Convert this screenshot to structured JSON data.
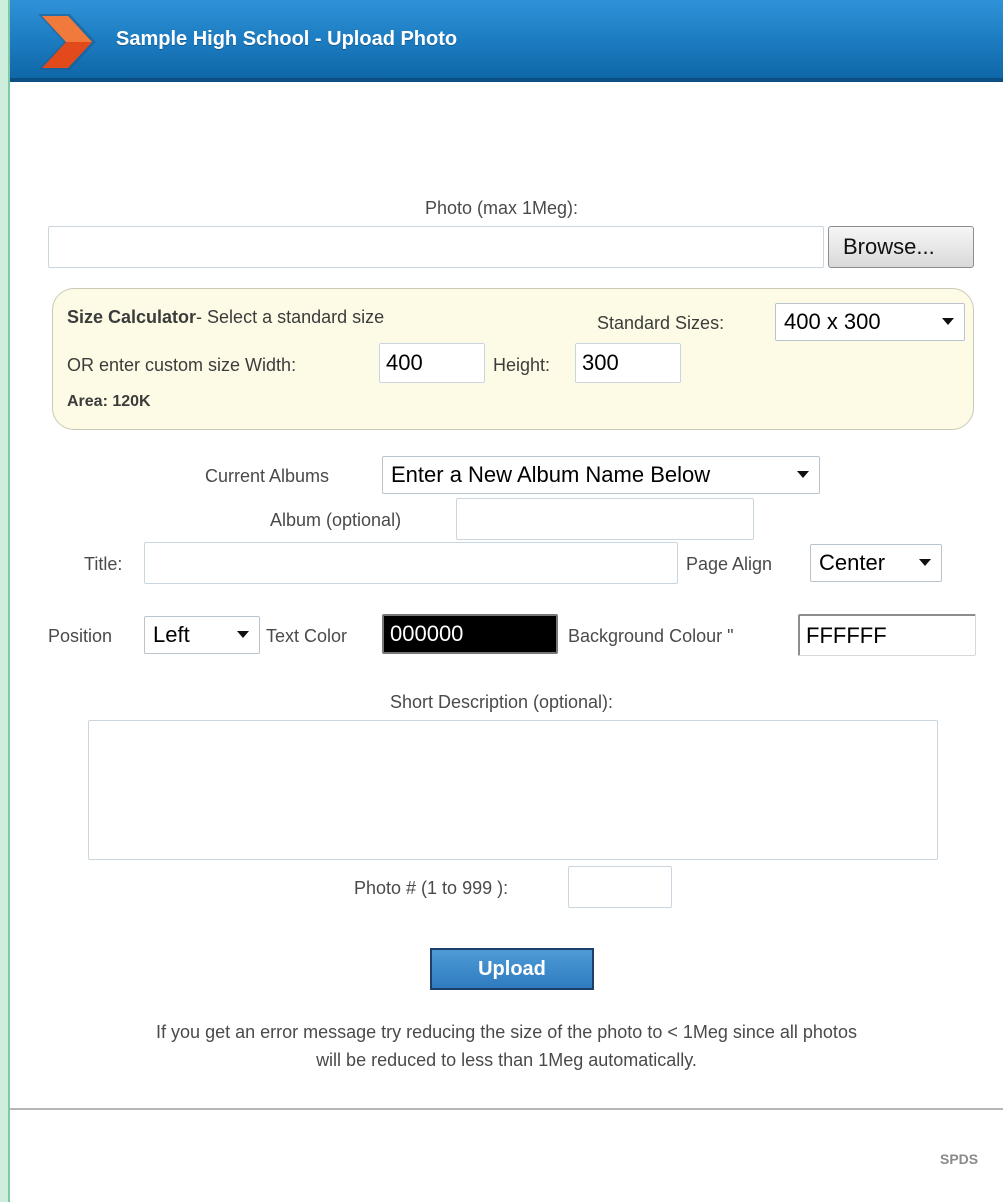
{
  "header": {
    "title": "Sample High School - Upload Photo"
  },
  "photo": {
    "label": "Photo (max 1Meg):",
    "value": "",
    "browse_label": "Browse..."
  },
  "size_calculator": {
    "title_bold": "Size Calculator",
    "title_rest": "- Select a standard size",
    "standard_sizes_label": "Standard Sizes:",
    "standard_sizes_value": "400 x 300",
    "custom_label": "OR enter custom size Width:",
    "width_value": "400",
    "height_label": "Height:",
    "height_value": "300",
    "area_label": "Area: 120K"
  },
  "albums": {
    "current_label": "Current Albums",
    "current_value": "Enter a New Album Name Below",
    "album_label": "Album (optional)",
    "album_value": ""
  },
  "title_row": {
    "title_label": "Title:",
    "title_value": "",
    "page_align_label": "Page Align",
    "page_align_value": "Center"
  },
  "position_row": {
    "position_label": "Position",
    "position_value": "Left",
    "text_color_label": "Text Color",
    "text_color_value": "000000",
    "bg_color_label": "Background Colour \"",
    "bg_color_value": "FFFFFF"
  },
  "description": {
    "label": "Short Description (optional):",
    "value": ""
  },
  "photo_number": {
    "label": "Photo # (1 to 999 ):",
    "value": ""
  },
  "actions": {
    "upload_label": "Upload"
  },
  "note": {
    "line1": "If you get an error message try reducing the size of the photo to < 1Meg since all photos",
    "line2": "will be reduced to less than 1Meg automatically."
  },
  "footer": {
    "text": "SPDS"
  },
  "colors": {
    "header": "#1f7fc4",
    "chevron": "#e24a1b",
    "size_box_bg": "#fdfbe5",
    "text_color_swatch": "#000000"
  }
}
